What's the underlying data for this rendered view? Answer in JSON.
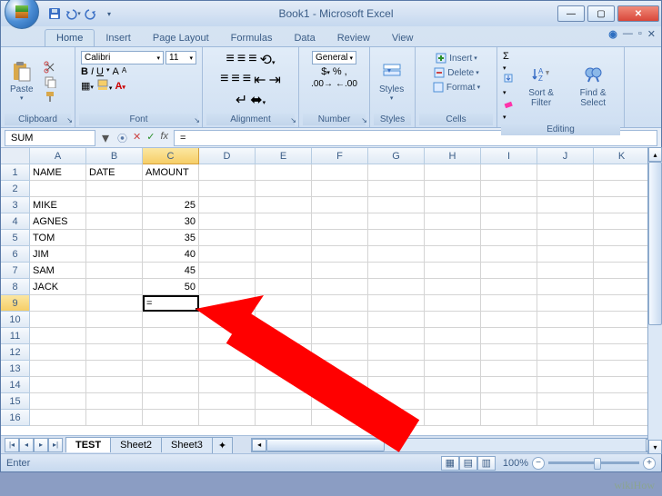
{
  "title": "Book1 - Microsoft Excel",
  "qat": {
    "save": "💾",
    "undo": "↶",
    "redo": "↷",
    "custom": "▾"
  },
  "tabs": [
    "Home",
    "Insert",
    "Page Layout",
    "Formulas",
    "Data",
    "Review",
    "View"
  ],
  "active_tab": 0,
  "ribbon": {
    "clipboard": {
      "label": "Clipboard",
      "paste": "Paste",
      "cut": "",
      "copy": "",
      "fmt": ""
    },
    "font": {
      "label": "Font",
      "face": "Calibri",
      "size": "11"
    },
    "alignment": {
      "label": "Alignment"
    },
    "number": {
      "label": "Number",
      "format": "General"
    },
    "styles": {
      "label": "Styles",
      "btn": "Styles"
    },
    "cells": {
      "label": "Cells",
      "insert": "Insert",
      "delete": "Delete",
      "format": "Format"
    },
    "editing": {
      "label": "Editing",
      "sort": "Sort & Filter",
      "find": "Find & Select"
    }
  },
  "namebox": "SUM",
  "formula": "=",
  "columns": [
    "A",
    "B",
    "C",
    "D",
    "E",
    "F",
    "G",
    "H",
    "I",
    "J",
    "K"
  ],
  "rows": 16,
  "active_cell": {
    "row": 9,
    "col": "C",
    "value": "="
  },
  "sheet_data": {
    "headers": {
      "A1": "NAME",
      "B1": "DATE",
      "C1": "AMOUNT"
    },
    "records": [
      {
        "row": 3,
        "name": "MIKE",
        "amount": 25
      },
      {
        "row": 4,
        "name": "AGNES",
        "amount": 30
      },
      {
        "row": 5,
        "name": "TOM",
        "amount": 35
      },
      {
        "row": 6,
        "name": "JIM",
        "amount": 40
      },
      {
        "row": 7,
        "name": "SAM",
        "amount": 45
      },
      {
        "row": 8,
        "name": "JACK",
        "amount": 50
      }
    ]
  },
  "sheets": [
    "TEST",
    "Sheet2",
    "Sheet3"
  ],
  "active_sheet": 0,
  "status": {
    "mode": "Enter",
    "zoom": "100%"
  },
  "watermark": "wikiHow"
}
